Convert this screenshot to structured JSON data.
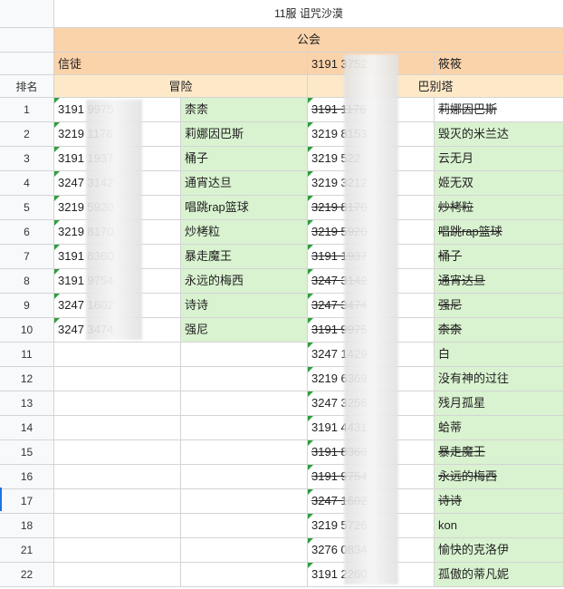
{
  "sheet": {
    "title": "11服 诅咒沙漠",
    "guild_header": "公会",
    "rank_header": "排名",
    "left_group": {
      "name": "信徒",
      "sub_header": "冒险",
      "ranks": [
        "1",
        "2",
        "3",
        "4",
        "5",
        "6",
        "7",
        "8",
        "9",
        "10"
      ],
      "ids": [
        "3191 9975",
        "3219 1176",
        "3191 1937",
        "3247 3142",
        "3219 5920",
        "3219 8170",
        "3191 8360",
        "3191 9754",
        "3247 1602",
        "3247 3474"
      ],
      "names": [
        "柰柰",
        "莉娜因巴斯",
        "桶子",
        "通宵达旦",
        "唱跳rap篮球",
        "炒栲粒",
        "暴走魔王",
        "永远的梅西",
        "诗诗",
        "强尼"
      ]
    },
    "right_group": {
      "id": "3191 3752",
      "name": "筱筱",
      "sub_header": "巴别塔",
      "ranks": [
        "1",
        "2",
        "3",
        "4",
        "5",
        "6",
        "7",
        "8",
        "9",
        "10",
        "11",
        "12",
        "13",
        "14",
        "15",
        "16",
        "17",
        "18",
        "21",
        "22"
      ],
      "ids": [
        "3191 1176",
        "3219 8153",
        "3219 522",
        "3219 3212",
        "3219 8170",
        "3219 5920",
        "3191 1937",
        "3247 3142",
        "3247 3474",
        "3191 9975",
        "3247 1429",
        "3219 6369",
        "3247 3256",
        "3191 4431",
        "3191 8360",
        "3191 9754",
        "3247 1602",
        "3219 5726",
        "3276 0834",
        "3191 2260"
      ],
      "names": [
        "莉娜因巴斯",
        "毁灭的米兰达",
        "云无月",
        "姬无双",
        "炒栲粒",
        "唱跳rap篮球",
        "桶子",
        "通宵达旦",
        "强尼",
        "柰柰",
        "白",
        "没有神的过往",
        "残月孤星",
        "蛤蒂",
        "暴走魔王",
        "永远的梅西",
        "诗诗",
        "kon",
        "愉快的克洛伊",
        "孤傲的蒂凡妮"
      ],
      "struck": [
        true,
        false,
        false,
        false,
        true,
        true,
        true,
        true,
        true,
        true,
        false,
        false,
        false,
        false,
        true,
        true,
        true,
        false,
        false,
        false
      ]
    }
  }
}
